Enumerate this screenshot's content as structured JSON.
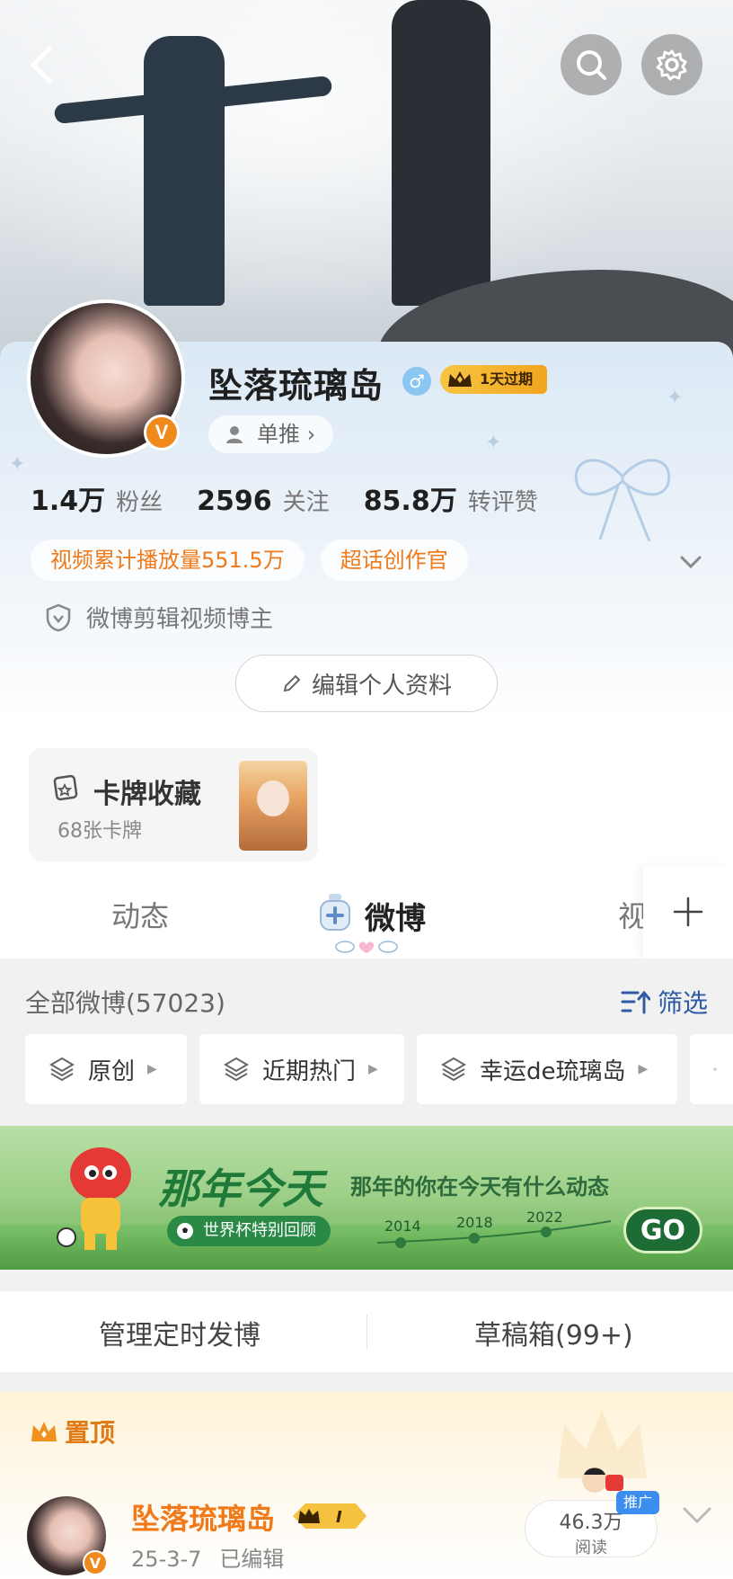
{
  "header": {
    "back_icon": "chevron-left-icon",
    "search_icon": "search-icon",
    "settings_icon": "gear-icon"
  },
  "profile": {
    "name": "坠落琉璃岛",
    "gender_symbol": "♂",
    "vip_label": "1天过期",
    "verified_badge": "V",
    "single_push_label": "单推 ›",
    "stats": [
      {
        "num": "1.4万",
        "label": "粉丝"
      },
      {
        "num": "2596",
        "label": "关注"
      },
      {
        "num": "85.8万",
        "label": "转评赞"
      }
    ],
    "tags": [
      "视频累计播放量551.5万",
      "超话创作官"
    ],
    "certification": "微博剪辑视频博主",
    "edit_button": "编辑个人资料"
  },
  "card_collection": {
    "title": "卡牌收藏",
    "subtitle": "68张卡牌"
  },
  "tabs": {
    "items": [
      "动态",
      "微博",
      "视"
    ],
    "active": "微博"
  },
  "feed_filter": {
    "all_label": "全部微博(57023)",
    "filter_label": "筛选",
    "chips": [
      "原创",
      "近期热门",
      "幸运de琉璃岛"
    ]
  },
  "ad_banner": {
    "title": "那年今天",
    "subtitle": "那年的你在今天有什么动态",
    "pill": "世界杯特别回顾",
    "years": [
      "2014",
      "2018",
      "2022"
    ],
    "go_label": "GO"
  },
  "actions": {
    "scheduled": "管理定时发博",
    "drafts": "草稿箱(99+)"
  },
  "pinned_post": {
    "section_label": "置顶",
    "author": "坠落琉璃岛",
    "vip_mark": "I",
    "date": "25-3-7",
    "edited_label": "已编辑",
    "reads_num": "46.3万",
    "reads_label": "阅读",
    "promo_label": "推广"
  },
  "colors": {
    "accent_orange": "#f07a1a",
    "link_blue": "#2f5aa4",
    "vip_gold": "#f2a51f"
  }
}
